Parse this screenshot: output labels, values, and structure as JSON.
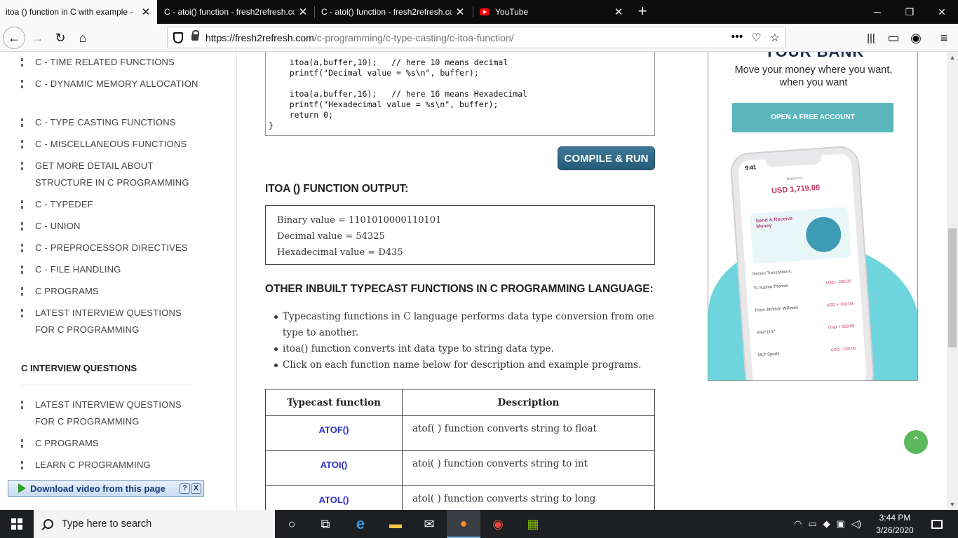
{
  "browser": {
    "tabs": [
      {
        "title": "itoa () function in C with example -",
        "active": true
      },
      {
        "title": "C - atoi() function - fresh2refresh.co",
        "active": false
      },
      {
        "title": "C - atol() function - fresh2refresh.co",
        "active": false
      },
      {
        "title": "YouTube",
        "active": false
      }
    ],
    "new_tab": "+",
    "url_host": "https://fresh2refresh.com",
    "url_path": "/c-programming/c-type-casting/c-itoa-function/",
    "url_more": "•••"
  },
  "sidebar": {
    "items": [
      "C - TIME RELATED FUNCTIONS",
      "C - DYNAMIC MEMORY ALLOCATION",
      "C - TYPE CASTING FUNCTIONS",
      "C - MISCELLANEOUS FUNCTIONS",
      "GET MORE DETAIL ABOUT STRUCTURE IN C PROGRAMMING",
      "C - TYPEDEF",
      "C - UNION",
      "C - PREPROCESSOR DIRECTIVES",
      "C - FILE HANDLING",
      "C PROGRAMS",
      "LATEST INTERVIEW QUESTIONS FOR C PROGRAMMING"
    ],
    "section_title": "C INTERVIEW QUESTIONS",
    "section_items": [
      "LATEST INTERVIEW QUESTIONS FOR C PROGRAMMING",
      "C PROGRAMS",
      "LEARN C PROGRAMMING"
    ]
  },
  "main": {
    "code_lines": [
      "    itoa(a,buffer,10);   // here 10 means decimal",
      "    printf(\"Decimal value = %s\\n\", buffer);",
      "",
      "    itoa(a,buffer,16);   // here 16 means Hexadecimal",
      "    printf(\"Hexadecimal value = %s\\n\", buffer);",
      "    return 0;",
      "}"
    ],
    "compile_button": "COMPILE & RUN",
    "output_heading": "ITOA () FUNCTION OUTPUT:",
    "output_lines": [
      "Binary value = 1101010000110101",
      "Decimal value = 54325",
      "Hexadecimal value = D435"
    ],
    "other_heading": "OTHER INBUILT TYPECAST FUNCTIONS IN C PROGRAMMING LANGUAGE:",
    "bullets": [
      "Typecasting functions in C language performs data type conversion from one type to another.",
      "itoa() function converts int data type to string data type.",
      "Click on each function name below for description and example programs."
    ],
    "table": {
      "headers": [
        "Typecast function",
        "Description"
      ],
      "rows": [
        {
          "fn": "ATOF()",
          "desc": "atof( ) function converts string to float"
        },
        {
          "fn": "ATOI()",
          "desc": "atoi( ) function converts string to int"
        },
        {
          "fn": "ATOL()",
          "desc": "atol( ) function converts string to long"
        }
      ]
    }
  },
  "ad": {
    "brand": "YOUR BANK",
    "tagline": "Move your money where you want, when you want",
    "cta": "OPEN A FREE ACCOUNT",
    "phone": {
      "time": "9:41",
      "balance_label": "Balance:",
      "balance": "USD 1,719.00",
      "card_title": "Send & Receive Money",
      "recent_label": "Recent Transactions:",
      "transactions": [
        {
          "name": "To Sophia Thomas",
          "amount": "USD - 250.00"
        },
        {
          "name": "From Jackson Williams",
          "amount": "USD + 200.00"
        },
        {
          "name": "Visa*1157",
          "amount": "USD + 500.00"
        },
        {
          "name": "MLT Sports",
          "amount": "USD - 230.00"
        }
      ]
    }
  },
  "download_bar": {
    "label": "Download video from this page",
    "help": "?",
    "close": "X"
  },
  "taskbar": {
    "search_placeholder": "Type here to search",
    "time": "3:44 PM",
    "date": "3/26/2020"
  },
  "colors": {
    "accent_button": "#2e6a8a",
    "ad_cta": "#5ab6bb",
    "link_blue": "#2b2ec7",
    "scroll_top": "#5cb85c"
  }
}
